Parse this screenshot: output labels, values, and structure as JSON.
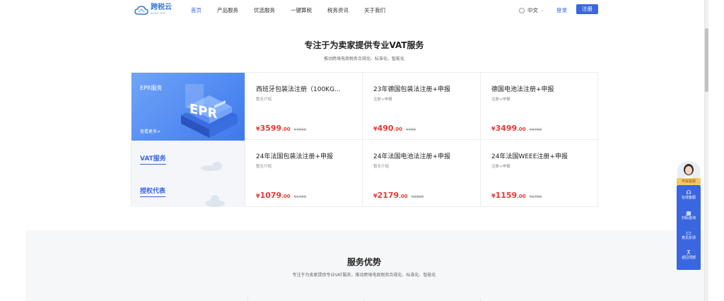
{
  "header": {
    "logo_text": "跨税云",
    "logo_sub": "ikasui.com",
    "nav": [
      "首页",
      "产品服务",
      "优选服务",
      "一键算税",
      "税务资讯",
      "关于我们"
    ],
    "lang": "中文",
    "login": "登录",
    "register": "注册",
    "accent_color": "#3a66e0"
  },
  "section1": {
    "title": "专注于为卖家提供专业VAT服务",
    "subtitle": "推动跨境电商税务合规化、标准化、智能化",
    "left": {
      "epr_label": "EPR服务",
      "epr_more": "查看更多>",
      "epr_art_text": "EPR",
      "tabs": [
        "VAT服务",
        "授权代表"
      ]
    },
    "cards": [
      {
        "title": "西班牙包装法注册（100KG...",
        "desc": "暂无介绍",
        "currency": "¥",
        "price_int": "3599",
        "price_dec": ".00",
        "orig": "¥4550"
      },
      {
        "title": "23年德国包装法注册+申报",
        "desc": "注册+申报",
        "currency": "¥",
        "price_int": "490",
        "price_dec": ".00",
        "orig": "¥799"
      },
      {
        "title": "德国电池法注册+申报",
        "desc": "注册+申报",
        "currency": "¥",
        "price_int": "3499",
        "price_dec": ".00",
        "orig": "¥3799"
      },
      {
        "title": "24年法国包装法注册+申报",
        "desc": "暂无介绍",
        "currency": "¥",
        "price_int": "1079",
        "price_dec": ".00",
        "orig": "¥1499"
      },
      {
        "title": "24年法国电池法注册+申报",
        "desc": "暂无介绍",
        "currency": "¥",
        "price_int": "2179",
        "price_dec": ".00",
        "orig": "¥2399"
      },
      {
        "title": "24年法国WEEE注册+申报",
        "desc": "注册+申报",
        "currency": "¥",
        "price_int": "1159",
        "price_dec": ".00",
        "orig": "¥1799"
      }
    ]
  },
  "section2": {
    "title": "服务优势",
    "subtitle": "专注于为卖家提供专业VAT服务，推动跨境电商税务合规化、标准化、智能化"
  },
  "side_widget": {
    "badge": "专属客服",
    "items": [
      {
        "icon": "headset-icon",
        "glyph": "☊",
        "label": "在线客服"
      },
      {
        "icon": "qrcode-icon",
        "glyph": "▦",
        "label": "扫码咨询"
      },
      {
        "icon": "feedback-icon",
        "glyph": "▭",
        "label": "意见反馈"
      },
      {
        "icon": "back-to-top-icon",
        "glyph": "⊼",
        "label": "返回顶部"
      }
    ]
  }
}
